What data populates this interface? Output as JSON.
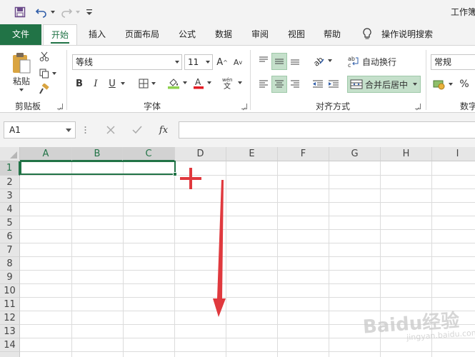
{
  "titlebar": {
    "title": "工作簿"
  },
  "tabs": [
    "文件",
    "开始",
    "插入",
    "页面布局",
    "公式",
    "数据",
    "审阅",
    "视图",
    "帮助",
    "操作说明搜索"
  ],
  "clipboard": {
    "paste_label": "粘贴",
    "group_label": "剪贴板"
  },
  "font": {
    "name": "等线",
    "size": "11",
    "bold": "B",
    "italic": "I",
    "underline": "U",
    "group_label": "字体",
    "font_color": "#e31b23",
    "fill_color": "#8fd14f"
  },
  "alignment": {
    "wrap_label": "自动换行",
    "merge_label": "合并后居中",
    "group_label": "对齐方式"
  },
  "number": {
    "format": "常规",
    "group_label": "数字"
  },
  "formula_bar": {
    "name_box": "A1",
    "fx": "fx"
  },
  "grid": {
    "columns": [
      "A",
      "B",
      "C",
      "D",
      "E",
      "F",
      "G",
      "H",
      "I"
    ],
    "rows": [
      "1",
      "2",
      "3",
      "4",
      "5",
      "6",
      "7",
      "8",
      "9",
      "10",
      "11",
      "12",
      "13",
      "14"
    ],
    "selected_columns": [
      "A",
      "B",
      "C"
    ],
    "selected_row": "1",
    "active_cell": "A1"
  },
  "annotation": {
    "color": "#e0393e"
  },
  "watermark": {
    "text": "Baidu经验",
    "sub": "jingyan.baidu.com"
  }
}
